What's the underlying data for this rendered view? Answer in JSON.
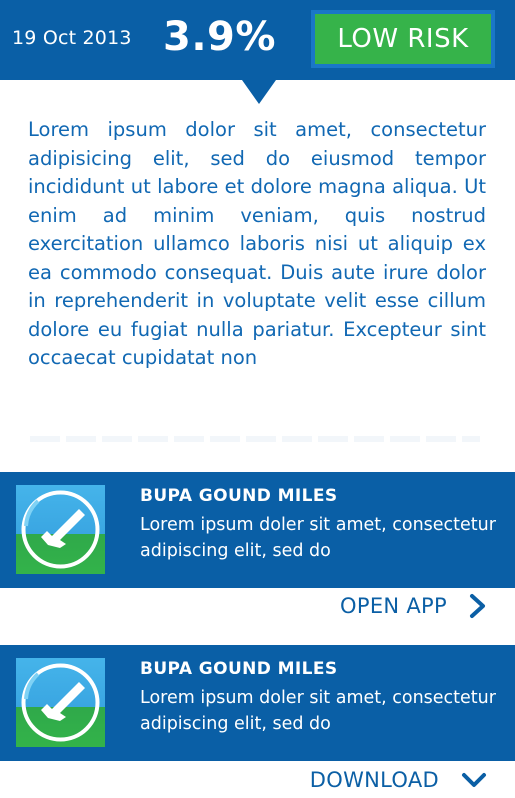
{
  "header": {
    "date": "19 Oct 2013",
    "percentage": "3.9%",
    "risk_label": "LOW RISK"
  },
  "article": {
    "text": "Lorem ipsum dolor sit amet, consectetur adipisicing elit, sed do eiusmod tempor incididunt ut labore et dolore magna aliqua. Ut enim ad minim veniam, quis nostrud exercitation ullamco laboris nisi ut aliquip ex ea commodo consequat. Duis aute irure dolor in reprehenderit in voluptate velit esse cillum dolore eu fugiat nulla pariatur. Excepteur sint occaecat cupidatat non"
  },
  "cards": [
    {
      "title": "BUPA GOUND MILES",
      "description": "Lorem ipsum doler sit amet, consectetur adipiscing elit, sed do",
      "action_label": "OPEN APP",
      "action_icon": "chevron-right-icon",
      "app_icon": "running-shoe-icon"
    },
    {
      "title": "BUPA GOUND MILES",
      "description": "Lorem ipsum doler sit amet, consectetur adipiscing elit, sed do",
      "action_label": "DOWNLOAD",
      "action_icon": "chevron-down-icon",
      "app_icon": "running-shoe-icon"
    }
  ],
  "colors": {
    "brand_blue": "#0a5fa6",
    "risk_green": "#36b34a",
    "text_blue": "#1168b3"
  }
}
